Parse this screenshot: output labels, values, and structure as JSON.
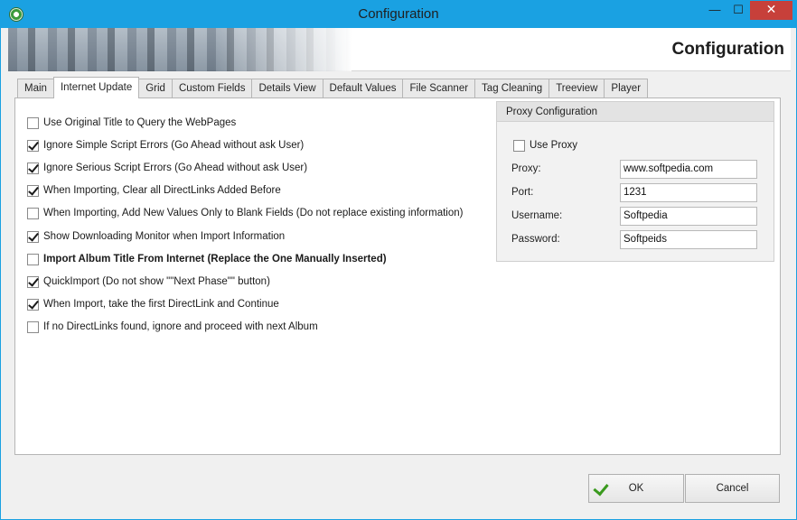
{
  "window": {
    "title": "Configuration",
    "minimize_glyph": "—",
    "maximize_glyph": "☐",
    "close_glyph": "✕"
  },
  "banner": {
    "title": "Configuration"
  },
  "tabs": [
    {
      "label": "Main",
      "active": false
    },
    {
      "label": "Internet Update",
      "active": true
    },
    {
      "label": "Grid",
      "active": false
    },
    {
      "label": "Custom Fields",
      "active": false
    },
    {
      "label": "Details View",
      "active": false
    },
    {
      "label": "Default Values",
      "active": false
    },
    {
      "label": "File Scanner",
      "active": false
    },
    {
      "label": "Tag Cleaning",
      "active": false
    },
    {
      "label": "Treeview",
      "active": false
    },
    {
      "label": "Player",
      "active": false
    }
  ],
  "options": [
    {
      "label": "Use Original Title to Query the WebPages",
      "checked": false
    },
    {
      "label": "Ignore Simple Script Errors (Go Ahead without ask User)",
      "checked": true
    },
    {
      "label": "Ignore Serious Script Errors (Go Ahead without ask User)",
      "checked": true
    },
    {
      "label": "When Importing, Clear all DirectLinks Added Before",
      "checked": true
    },
    {
      "label": "When Importing, Add New Values Only to Blank Fields (Do not replace existing information)",
      "checked": false
    },
    {
      "label": "Show Downloading Monitor when Import Information",
      "checked": true
    },
    {
      "label": "Import Album Title From Internet (Replace the One Manually Inserted)",
      "checked": false
    },
    {
      "label": "QuickImport (Do not show \"\"Next Phase\"\" button)",
      "checked": true
    },
    {
      "label": "When Import, take the first DirectLink and Continue",
      "checked": true
    },
    {
      "label": "If no DirectLinks found, ignore and proceed with next Album",
      "checked": false
    }
  ],
  "proxy": {
    "title": "Proxy Configuration",
    "use_proxy_label": "Use Proxy",
    "use_proxy_checked": false,
    "proxy_label": "Proxy:",
    "proxy_value": "www.softpedia.com",
    "port_label": "Port:",
    "port_value": "1231",
    "username_label": "Username:",
    "username_value": "Softpedia",
    "password_label": "Password:",
    "password_value": "Softpeids"
  },
  "buttons": {
    "ok": "OK",
    "cancel": "Cancel"
  },
  "colors": {
    "titlebar": "#1aa1e2",
    "close_button": "#c7403a",
    "ok_check": "#3a9a1e"
  },
  "icons": {
    "app": "app-gear-icon",
    "ok": "checkmark-icon"
  }
}
